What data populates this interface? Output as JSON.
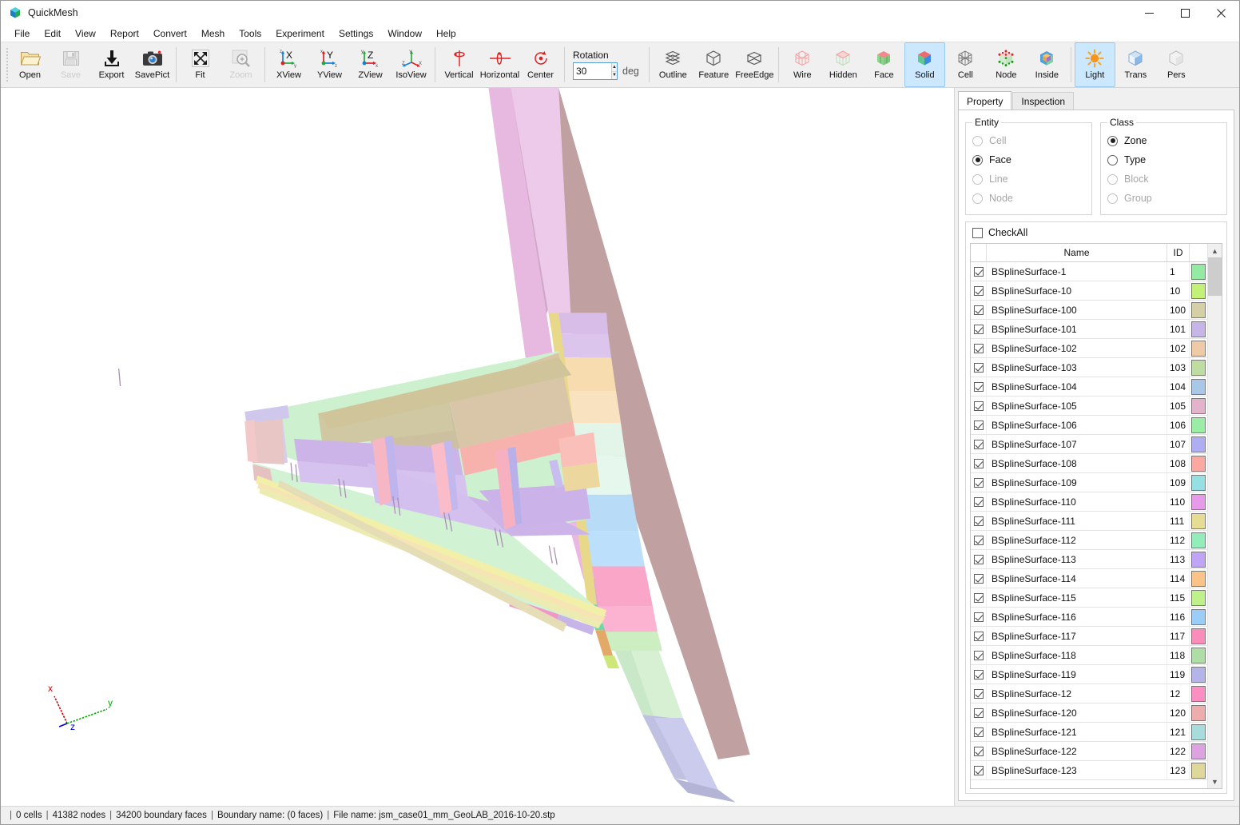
{
  "window": {
    "title": "QuickMesh",
    "icon": "app-cube-icon",
    "controls": {
      "minimize": "minimize-icon",
      "maximize": "maximize-icon",
      "close": "close-icon"
    }
  },
  "menubar": {
    "items": [
      "File",
      "Edit",
      "View",
      "Report",
      "Convert",
      "Mesh",
      "Tools",
      "Experiment",
      "Settings",
      "Window",
      "Help"
    ]
  },
  "toolbar": {
    "groups": [
      {
        "name": "file-group",
        "buttons": [
          {
            "label": "Open",
            "icon": "folder-open-icon",
            "enabled": true,
            "active": false
          },
          {
            "label": "Save",
            "icon": "floppy-disk-icon",
            "enabled": false,
            "active": false
          },
          {
            "label": "Export",
            "icon": "download-arrow-icon",
            "enabled": true,
            "active": false
          },
          {
            "label": "SavePict",
            "icon": "camera-icon",
            "enabled": true,
            "active": false
          }
        ]
      },
      {
        "name": "view-tools-group",
        "buttons": [
          {
            "label": "Fit",
            "icon": "fit-arrows-icon",
            "enabled": true,
            "active": false
          },
          {
            "label": "Zoom",
            "icon": "magnifier-plus-icon",
            "enabled": false,
            "active": false
          }
        ]
      },
      {
        "name": "axis-view-group",
        "buttons": [
          {
            "label": "XView",
            "icon": "x-axis-view-icon",
            "enabled": true,
            "active": false
          },
          {
            "label": "YView",
            "icon": "y-axis-view-icon",
            "enabled": true,
            "active": false
          },
          {
            "label": "ZView",
            "icon": "z-axis-view-icon",
            "enabled": true,
            "active": false
          },
          {
            "label": "IsoView",
            "icon": "iso-view-icon",
            "enabled": true,
            "active": false
          }
        ]
      },
      {
        "name": "rotate-group",
        "buttons": [
          {
            "label": "Vertical",
            "icon": "rotate-vertical-icon",
            "enabled": true,
            "active": false
          },
          {
            "label": "Horizontal",
            "icon": "rotate-horizontal-icon",
            "enabled": true,
            "active": false
          },
          {
            "label": "Center",
            "icon": "rotate-center-icon",
            "enabled": true,
            "active": false
          }
        ]
      }
    ],
    "rotation": {
      "label": "Rotation",
      "value": "30",
      "unit": "deg",
      "spinner_up": "spin-up-icon",
      "spinner_down": "spin-down-icon"
    },
    "display_groups": [
      {
        "name": "edge-group",
        "buttons": [
          {
            "label": "Outline",
            "icon": "outline-layers-icon",
            "enabled": true,
            "active": false
          },
          {
            "label": "Feature",
            "icon": "feature-cube-icon",
            "enabled": true,
            "active": false
          },
          {
            "label": "FreeEdge",
            "icon": "freeedge-layers-icon",
            "enabled": true,
            "active": false
          }
        ]
      },
      {
        "name": "render-group",
        "buttons": [
          {
            "label": "Wire",
            "icon": "wireframe-cube-icon",
            "enabled": true,
            "active": false
          },
          {
            "label": "Hidden",
            "icon": "hidden-line-cube-icon",
            "enabled": true,
            "active": false
          },
          {
            "label": "Face",
            "icon": "face-cube-icon",
            "enabled": true,
            "active": false
          },
          {
            "label": "Solid",
            "icon": "solid-cube-icon",
            "enabled": true,
            "active": true
          },
          {
            "label": "Cell",
            "icon": "cell-mesh-cube-icon",
            "enabled": true,
            "active": false
          },
          {
            "label": "Node",
            "icon": "node-points-cube-icon",
            "enabled": true,
            "active": false
          },
          {
            "label": "Inside",
            "icon": "inside-cut-cube-icon",
            "enabled": true,
            "active": false
          }
        ]
      },
      {
        "name": "shading-group",
        "buttons": [
          {
            "label": "Light",
            "icon": "light-sun-icon",
            "enabled": true,
            "active": true
          },
          {
            "label": "Trans",
            "icon": "transparency-cube-icon",
            "enabled": true,
            "active": false
          },
          {
            "label": "Pers",
            "icon": "perspective-cube-icon",
            "enabled": true,
            "active": false
          }
        ]
      }
    ]
  },
  "viewport": {
    "axis_gizmo": {
      "x_label": "x",
      "y_label": "y",
      "z_label": "z",
      "x_color": "#d40000",
      "y_color": "#00b000",
      "z_color": "#0000d4"
    },
    "background": "#ffffff"
  },
  "panel": {
    "tabs": [
      {
        "label": "Property",
        "selected": true
      },
      {
        "label": "Inspection",
        "selected": false
      }
    ],
    "entity": {
      "legend": "Entity",
      "options": [
        {
          "label": "Cell",
          "checked": false,
          "enabled": false
        },
        {
          "label": "Face",
          "checked": true,
          "enabled": true
        },
        {
          "label": "Line",
          "checked": false,
          "enabled": false
        },
        {
          "label": "Node",
          "checked": false,
          "enabled": false
        }
      ]
    },
    "klass": {
      "legend": "Class",
      "options": [
        {
          "label": "Zone",
          "checked": true,
          "enabled": true
        },
        {
          "label": "Type",
          "checked": false,
          "enabled": true
        },
        {
          "label": "Block",
          "checked": false,
          "enabled": false
        },
        {
          "label": "Group",
          "checked": false,
          "enabled": false
        }
      ]
    },
    "check_all": {
      "label": "CheckAll",
      "checked": false
    },
    "table": {
      "headers": {
        "check": "",
        "name": "Name",
        "id": "ID",
        "color": ""
      },
      "rows": [
        {
          "checked": true,
          "name": "BSplineSurface-1",
          "id": "1",
          "color": "#94eaa3"
        },
        {
          "checked": true,
          "name": "BSplineSurface-10",
          "id": "10",
          "color": "#c3f077"
        },
        {
          "checked": true,
          "name": "BSplineSurface-100",
          "id": "100",
          "color": "#d4cfa4"
        },
        {
          "checked": true,
          "name": "BSplineSurface-101",
          "id": "101",
          "color": "#c6b6e8"
        },
        {
          "checked": true,
          "name": "BSplineSurface-102",
          "id": "102",
          "color": "#eecaa6"
        },
        {
          "checked": true,
          "name": "BSplineSurface-103",
          "id": "103",
          "color": "#bfdda2"
        },
        {
          "checked": true,
          "name": "BSplineSurface-104",
          "id": "104",
          "color": "#a9c8e8"
        },
        {
          "checked": true,
          "name": "BSplineSurface-105",
          "id": "105",
          "color": "#e3b2cb"
        },
        {
          "checked": true,
          "name": "BSplineSurface-106",
          "id": "106",
          "color": "#9aeda5"
        },
        {
          "checked": true,
          "name": "BSplineSurface-107",
          "id": "107",
          "color": "#afaef3"
        },
        {
          "checked": true,
          "name": "BSplineSurface-108",
          "id": "108",
          "color": "#fba8a2"
        },
        {
          "checked": true,
          "name": "BSplineSurface-109",
          "id": "109",
          "color": "#96e0e3"
        },
        {
          "checked": true,
          "name": "BSplineSurface-110",
          "id": "110",
          "color": "#e79aea"
        },
        {
          "checked": true,
          "name": "BSplineSurface-111",
          "id": "111",
          "color": "#e7dc94"
        },
        {
          "checked": true,
          "name": "BSplineSurface-112",
          "id": "112",
          "color": "#93edbb"
        },
        {
          "checked": true,
          "name": "BSplineSurface-113",
          "id": "113",
          "color": "#c0a4f5"
        },
        {
          "checked": true,
          "name": "BSplineSurface-114",
          "id": "114",
          "color": "#fbc387"
        },
        {
          "checked": true,
          "name": "BSplineSurface-115",
          "id": "115",
          "color": "#c0f08a"
        },
        {
          "checked": true,
          "name": "BSplineSurface-116",
          "id": "116",
          "color": "#9ccdf6"
        },
        {
          "checked": true,
          "name": "BSplineSurface-117",
          "id": "117",
          "color": "#f98cb8"
        },
        {
          "checked": true,
          "name": "BSplineSurface-118",
          "id": "118",
          "color": "#afdda6"
        },
        {
          "checked": true,
          "name": "BSplineSurface-119",
          "id": "119",
          "color": "#b4b4e8"
        },
        {
          "checked": true,
          "name": "BSplineSurface-12",
          "id": "12",
          "color": "#fb8fc2"
        },
        {
          "checked": true,
          "name": "BSplineSurface-120",
          "id": "120",
          "color": "#eeadad"
        },
        {
          "checked": true,
          "name": "BSplineSurface-121",
          "id": "121",
          "color": "#a7dbdc"
        },
        {
          "checked": true,
          "name": "BSplineSurface-122",
          "id": "122",
          "color": "#dda2e0"
        },
        {
          "checked": true,
          "name": "BSplineSurface-123",
          "id": "123",
          "color": "#ded99a"
        }
      ],
      "scrollbar": {
        "up": "scroll-up-icon",
        "down": "scroll-down-icon"
      }
    }
  },
  "statusbar": {
    "cells": "0 cells",
    "nodes": "41382 nodes",
    "boundary_faces": "34200 boundary faces",
    "boundary_name": "Boundary name:  (0 faces)",
    "file_name": "File name: jsm_case01_mm_GeoLAB_2016-10-20.stp"
  }
}
